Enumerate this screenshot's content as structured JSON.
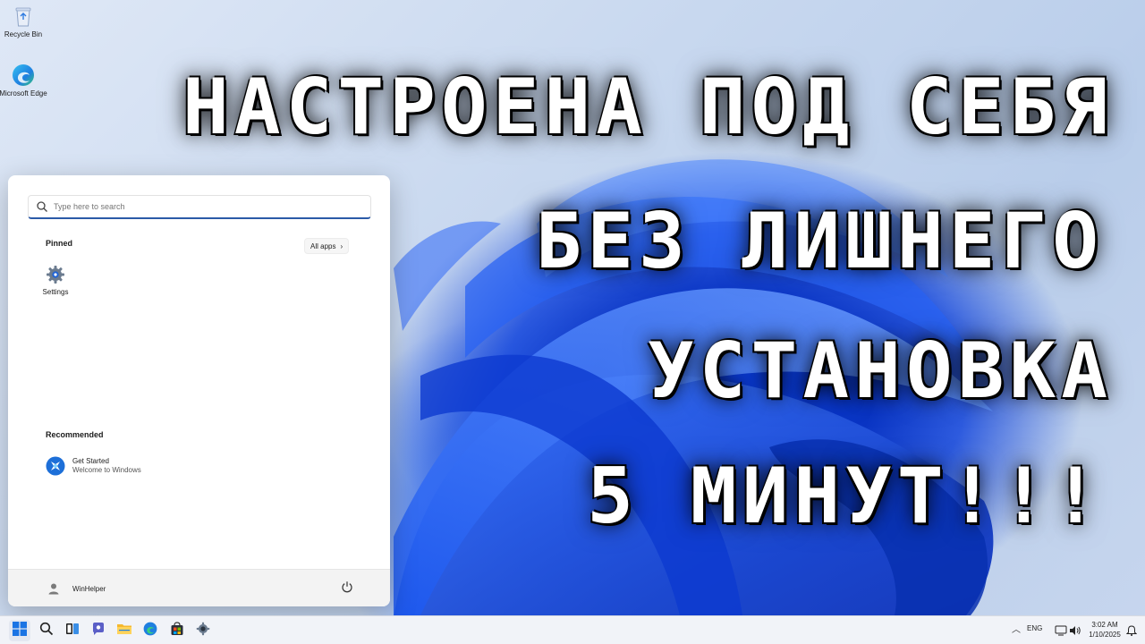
{
  "desktop": {
    "icons": [
      {
        "label": "Recycle Bin",
        "icon": "recycle-bin-icon"
      },
      {
        "label": "Microsoft Edge",
        "icon": "edge-icon"
      }
    ]
  },
  "headline": {
    "lines": [
      "НАСТРОЕНА ПОД СЕБЯ",
      "БЕЗ ЛИШНЕГО",
      "УСТАНОВКА",
      "5 МИНУТ!!!"
    ]
  },
  "start_menu": {
    "search_placeholder": "Type here to search",
    "pinned_title": "Pinned",
    "all_apps_label": "All apps",
    "pinned_apps": [
      {
        "label": "Settings",
        "icon": "settings-gear-icon"
      }
    ],
    "recommended_title": "Recommended",
    "recommended": [
      {
        "title": "Get Started",
        "subtitle": "Welcome to Windows",
        "icon": "get-started-icon"
      }
    ],
    "user_name": "WinHelper",
    "power_icon": "power-icon"
  },
  "taskbar": {
    "buttons": [
      {
        "name": "start",
        "icon": "windows-logo-icon"
      },
      {
        "name": "search",
        "icon": "search-icon"
      },
      {
        "name": "task-view",
        "icon": "task-view-icon"
      },
      {
        "name": "chat",
        "icon": "chat-icon"
      },
      {
        "name": "file-explorer",
        "icon": "folder-icon"
      },
      {
        "name": "edge",
        "icon": "edge-icon"
      },
      {
        "name": "store",
        "icon": "store-icon"
      },
      {
        "name": "settings",
        "icon": "settings-gear-icon"
      }
    ],
    "language": "ENG",
    "time": "3:02 AM",
    "date": "1/10/2025"
  },
  "colors": {
    "accent": "#2b5aa8",
    "bloom_blue": "#0b3bd6",
    "taskbar_bg": "#f1f3f8"
  }
}
